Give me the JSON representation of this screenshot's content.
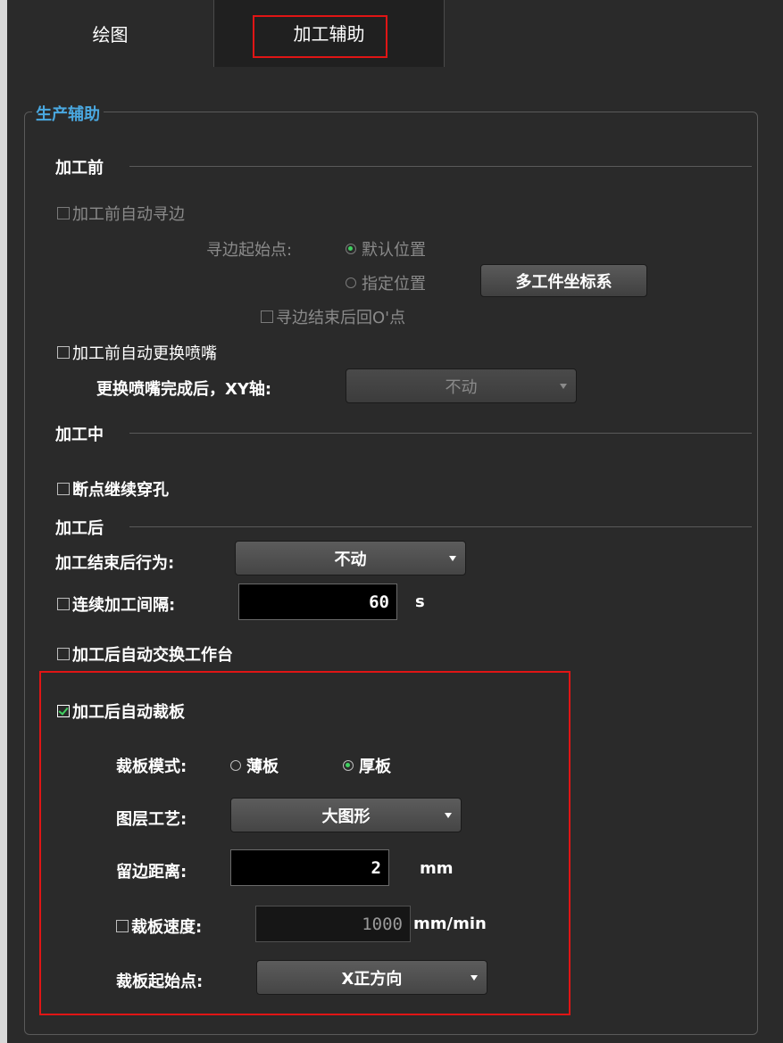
{
  "tabs": [
    {
      "label": "绘图"
    },
    {
      "label": "加工辅助"
    }
  ],
  "group": {
    "title": "生产辅助"
  },
  "before": {
    "header": "加工前",
    "auto_edge_label": "加工前自动寻边",
    "edge_start_label": "寻边起始点:",
    "radio_default": "默认位置",
    "radio_specified": "指定位置",
    "multi_coord_button": "多工件坐标系",
    "return_origin_label": "寻边结束后回O'点",
    "auto_nozzle_label": "加工前自动更换喷嘴",
    "after_nozzle_label": "更换喷嘴完成后，XY轴:",
    "after_nozzle_value": "不动"
  },
  "during": {
    "header": "加工中",
    "breakpoint_pierce_label": "断点继续穿孔"
  },
  "after": {
    "header": "加工后",
    "end_behavior_label": "加工结束后行为:",
    "end_behavior_value": "不动",
    "interval_label": "连续加工间隔:",
    "interval_value": "60",
    "interval_unit": "s",
    "swap_table_label": "加工后自动交换工作台",
    "auto_trim_label": "加工后自动裁板",
    "trim_mode_label": "裁板模式:",
    "trim_thin": "薄板",
    "trim_thick": "厚板",
    "layer_process_label": "图层工艺:",
    "layer_process_value": "大图形",
    "margin_label": "留边距离:",
    "margin_value": "2",
    "margin_unit": "mm",
    "trim_speed_label": "裁板速度:",
    "trim_speed_value": "1000",
    "trim_speed_unit": "mm/min",
    "trim_start_label": "裁板起始点:",
    "trim_start_value": "X正方向"
  },
  "colors": {
    "accent_title": "#4aa8e0",
    "highlight": "#e01515",
    "check_green": "#40d060"
  }
}
